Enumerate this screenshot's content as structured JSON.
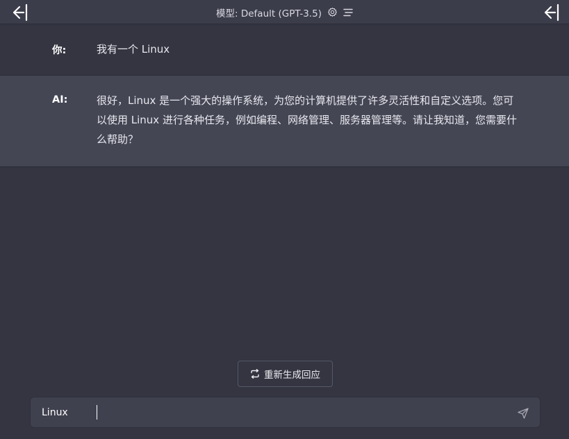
{
  "header": {
    "model_label": "模型: Default (GPT-3.5)",
    "icons": {
      "left_toggle": "arrow-left-bar-icon",
      "right_toggle": "arrow-left-bar-icon",
      "settings": "gear-icon",
      "menu": "menu-lines-icon"
    }
  },
  "conversation": {
    "messages": [
      {
        "role_label": "你:",
        "text": "我有一个 Linux"
      },
      {
        "role_label": "AI:",
        "text": "很好，Linux 是一个强大的操作系统，为您的计算机提供了许多灵活性和自定义选项。您可以使用 Linux 进行各种任务，例如编程、网络管理、服务器管理等。请让我知道，您需要什么帮助？"
      }
    ]
  },
  "regenerate": {
    "label": "重新生成回应",
    "icon": "refresh-icon"
  },
  "composer": {
    "value": "Linux",
    "send_icon": "send-icon"
  },
  "colors": {
    "background": "#343541",
    "ai_message_bg": "#444654",
    "input_bg": "#40414f"
  }
}
